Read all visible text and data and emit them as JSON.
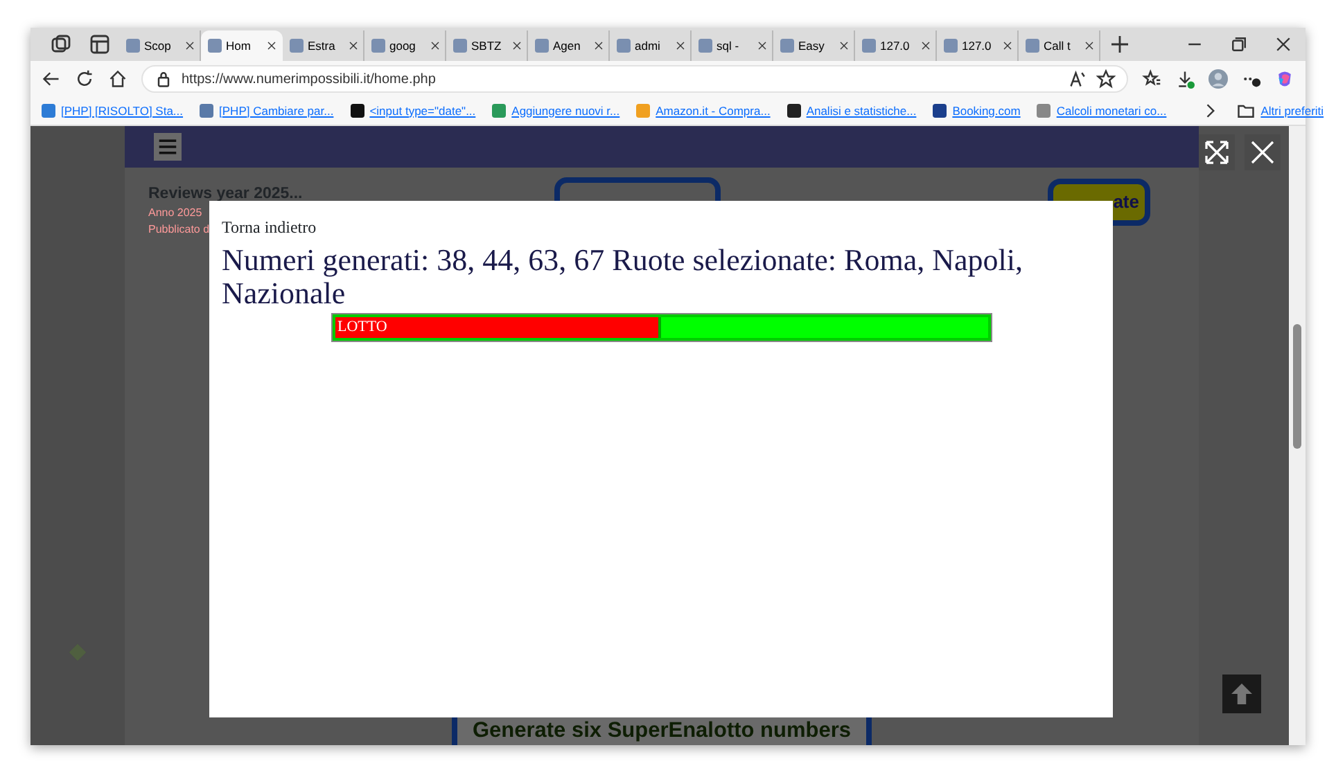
{
  "browser": {
    "tabs": [
      {
        "label": "Scop",
        "selected": false
      },
      {
        "label": "Hom",
        "selected": true
      },
      {
        "label": "Estra",
        "selected": false
      },
      {
        "label": "goog",
        "selected": false
      },
      {
        "label": "SBTZ",
        "selected": false
      },
      {
        "label": "Agen",
        "selected": false
      },
      {
        "label": "admi",
        "selected": false
      },
      {
        "label": "sql -",
        "selected": false
      },
      {
        "label": "Easy",
        "selected": false
      },
      {
        "label": "127.0",
        "selected": false
      },
      {
        "label": "127.0",
        "selected": false
      },
      {
        "label": "Call t",
        "selected": false
      }
    ],
    "address": "https://www.numerimpossibili.it/home.php",
    "bookmarks": [
      "[PHP] [RISOLTO] Sta...",
      "[PHP] Cambiare par...",
      "<input type=\"date\"...",
      "Aggiungere nuovi r...",
      "Amazon.it - Compra...",
      "Analisi e statistiche...",
      "Booking.com",
      "Calcoli monetari co..."
    ],
    "other_bookmarks": "Altri preferiti"
  },
  "page": {
    "review_link": "Reviews year 2025...",
    "review_year": "Anno 2025",
    "review_published": "Pubblicato d",
    "header_button": "ate",
    "bottom_button": "Generate six SuperEnalotto numbers"
  },
  "modal": {
    "back_link": "Torna indietro",
    "message": "Numeri generati: 38, 44, 63, 67 Ruote selezionate: Roma, Napoli, Nazionale",
    "bar": {
      "label": "LOTTO",
      "level": 0.5
    }
  }
}
